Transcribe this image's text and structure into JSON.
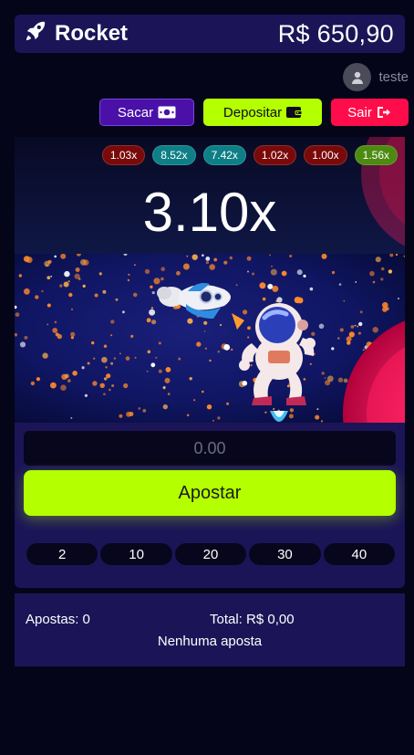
{
  "header": {
    "brand": "Rocket",
    "balance": "R$ 650,90"
  },
  "user": {
    "name": "teste"
  },
  "buttons": {
    "sacar": "Sacar",
    "depositar": "Depositar",
    "sair": "Sair"
  },
  "history": [
    {
      "value": "1.03x",
      "color": "#7a0a0a"
    },
    {
      "value": "8.52x",
      "color": "#0e7f86"
    },
    {
      "value": "7.42x",
      "color": "#0e7f86"
    },
    {
      "value": "1.02x",
      "color": "#7a0a0a"
    },
    {
      "value": "1.00x",
      "color": "#7a0a0a"
    },
    {
      "value": "1.56x",
      "color": "#4c8a12"
    }
  ],
  "game": {
    "multiplier": "3.10x"
  },
  "bet_panel": {
    "amount_placeholder": "0.00",
    "bet_label": "Apostar",
    "quick": [
      "2",
      "10",
      "20",
      "30",
      "40"
    ]
  },
  "bets": {
    "count": "Apostas: 0",
    "total": "Total: R$ 0,00",
    "empty": "Nenhuma aposta"
  },
  "colors": {
    "accent": "#b4ff00",
    "danger": "#ff0d4a",
    "panel": "#1b1557",
    "purple": "#4a10a8"
  }
}
